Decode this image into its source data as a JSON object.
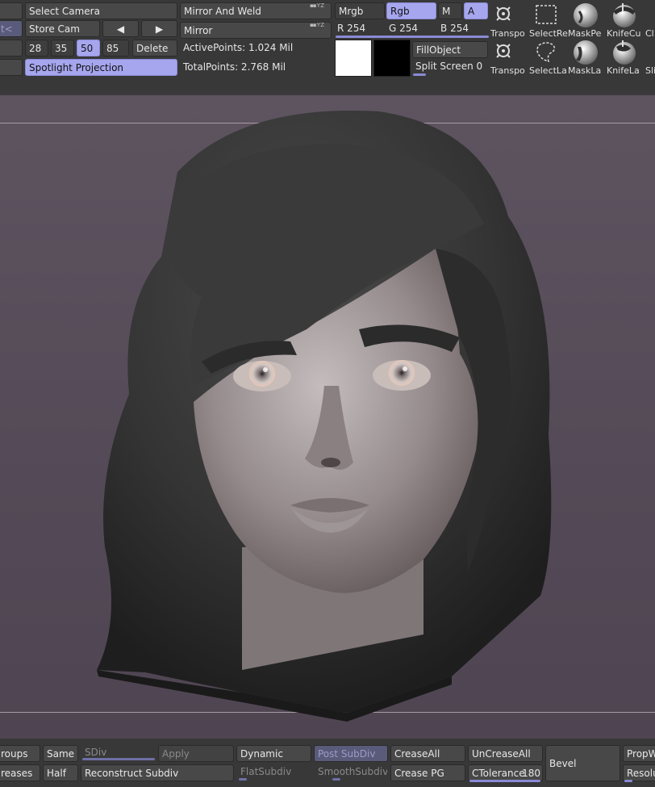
{
  "top": {
    "camera": {
      "select_camera": "Select Camera",
      "store_cam": "Store Cam",
      "prev_arrow": "◀",
      "next_arrow": "▶",
      "fov_values": [
        "28",
        "35",
        "50",
        "85"
      ],
      "fov_selected": "50",
      "delete": "Delete",
      "spotlight_projection": "Spotlight Projection",
      "left_partial": "t<"
    },
    "mesh": {
      "mirror_and_weld": "Mirror And Weld",
      "mirror": "Mirror",
      "active_points": "ActivePoints: 1.024 Mil",
      "total_points": "TotalPoints: 2.768 Mil"
    },
    "color": {
      "mrgb": "Mrgb",
      "rgb": "Rgb",
      "m": "M",
      "a": "A",
      "r_label": "R",
      "r_value": "254",
      "g_label": "G",
      "g_value": "254",
      "b_label": "B",
      "b_value": "254",
      "fill_object": "FillObject",
      "split_screen": "Split Screen",
      "split_screen_value": "0",
      "primary_color": "#ffffff",
      "secondary_color": "#000000"
    },
    "tools": [
      {
        "label": "Transpo",
        "icon": "transpose-gizmo-icon"
      },
      {
        "label": "SelectRe",
        "icon": "select-rect-icon"
      },
      {
        "label": "MaskPe",
        "icon": "mask-pen-icon"
      },
      {
        "label": "KnifeCu",
        "icon": "knife-curve-icon"
      },
      {
        "label": "Cl",
        "icon": "clip-icon"
      },
      {
        "label": "Transpo",
        "icon": "transpose-gizmo-icon"
      },
      {
        "label": "SelectLa",
        "icon": "select-lasso-icon"
      },
      {
        "label": "MaskLa",
        "icon": "mask-lasso-icon"
      },
      {
        "label": "KnifeLa",
        "icon": "knife-lasso-icon"
      },
      {
        "label": "Sli",
        "icon": "slice-icon"
      }
    ]
  },
  "bottom": {
    "groups": "roups",
    "same": "Same",
    "sdiv": "SDiv",
    "apply": "Apply",
    "dynamic": "Dynamic",
    "post_subdiv": "Post SubDiv",
    "crease_all": "CreaseAll",
    "uncrease_all": "UnCreaseAll",
    "bevel": "Bevel",
    "propw": "PropW",
    "creases": "reases",
    "half": "Half",
    "reconstruct_subdiv": "Reconstruct Subdiv",
    "flat_subdiv": "FlatSubdiv",
    "smooth_subdiv": "SmoothSubdiv",
    "crease_pg": "Crease PG",
    "ctolerance": "CTolerance",
    "ctolerance_value": "180",
    "resolu": "Resolu"
  },
  "colors": {
    "accent": "#a6a6ee",
    "panel": "#3a3a3a",
    "button": "#484848",
    "viewport": "#574d5a"
  }
}
